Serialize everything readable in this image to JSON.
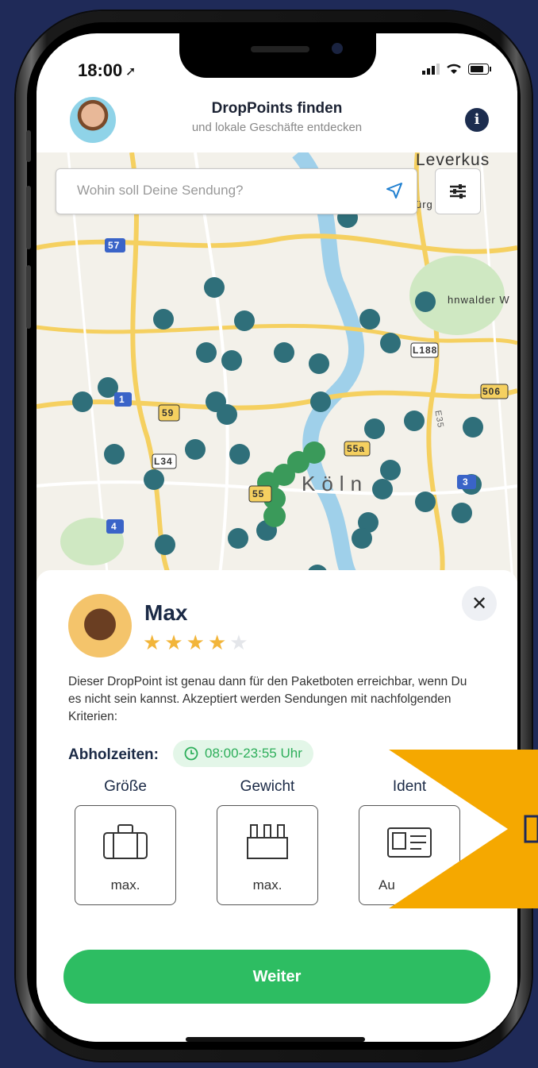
{
  "status_bar": {
    "time": "18:00"
  },
  "header": {
    "title": "DropPoints finden",
    "subtitle": "und lokale Geschäfte entdecken",
    "info_icon": "info-icon"
  },
  "search": {
    "placeholder": "Wohin soll Deine Sendung?",
    "location_icon": "location-arrow-icon",
    "filter_icon": "sliders-icon"
  },
  "map": {
    "labels": [
      "Leverkus",
      "Köln",
      "hnwalder W",
      "ürg"
    ],
    "road_signs": [
      "57",
      "1",
      "59",
      "L34",
      "55",
      "4",
      "55a",
      "L188",
      "506",
      "3",
      "E35"
    ],
    "pin_color": "#2f6f7a",
    "accent_pin_color": "#3a9a5a"
  },
  "droppoint": {
    "name": "Max",
    "rating": 4,
    "rating_max": 5,
    "description": "Dieser DropPoint ist genau dann für den Paketboten erreichbar, wenn Du es nicht sein kannst. Akzeptiert werden Sendungen mit nachfolgenden Kriterien:",
    "hours_label": "Abholzeiten:",
    "hours_value": "08:00-23:55 Uhr",
    "criteria": [
      {
        "title": "Größe",
        "value": "max.",
        "icon": "suitcase-icon"
      },
      {
        "title": "Gewicht",
        "value": "max.",
        "icon": "bottle-crate-icon"
      },
      {
        "title": "Ident",
        "value": "Au",
        "icon": "id-card-icon"
      }
    ],
    "cta_label": "Weiter"
  },
  "colors": {
    "background": "#1f2a58",
    "primary_green": "#2dbd62",
    "navy": "#1b2a46",
    "star": "#f2b53a",
    "overlay_arrow": "#f5a800"
  }
}
